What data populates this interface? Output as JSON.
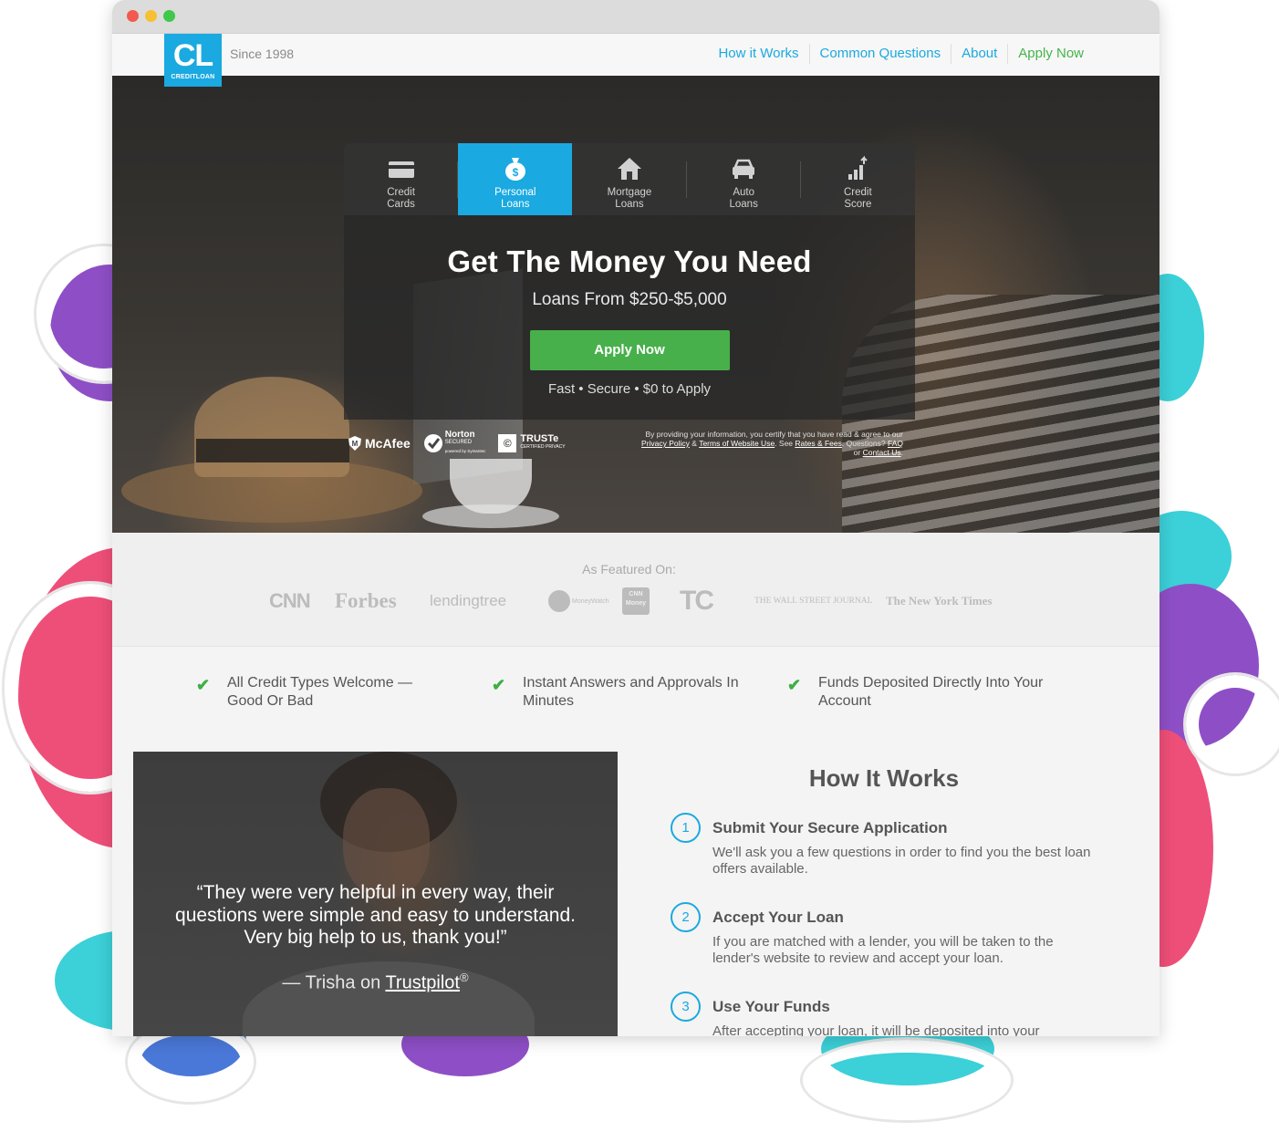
{
  "browser": {
    "controls": [
      "close",
      "minimize",
      "maximize"
    ]
  },
  "header": {
    "logo": {
      "mark": "CL",
      "name": "CREDITLOAN"
    },
    "since": "Since 1998",
    "nav": [
      {
        "label": "How it Works"
      },
      {
        "label": "Common Questions"
      },
      {
        "label": "About"
      },
      {
        "label": "Apply Now"
      }
    ]
  },
  "hero": {
    "tabs": [
      {
        "line1": "Credit",
        "line2": "Cards",
        "icon": "credit-card-icon"
      },
      {
        "line1": "Personal",
        "line2": "Loans",
        "icon": "money-bag-icon",
        "active": true
      },
      {
        "line1": "Mortgage",
        "line2": "Loans",
        "icon": "house-icon"
      },
      {
        "line1": "Auto",
        "line2": "Loans",
        "icon": "car-icon"
      },
      {
        "line1": "Credit",
        "line2": "Score",
        "icon": "bar-chart-icon"
      }
    ],
    "headline": "Get The Money You Need",
    "subline": "Loans From $250-$5,000",
    "cta": "Apply Now",
    "tagline": "Fast • Secure • $0 to Apply",
    "badges": {
      "mcafee": "McAfee",
      "norton": "Norton",
      "norton_sub": "SECURED",
      "norton_small": "powered by Symantec",
      "truste": "TRUSTe",
      "truste_sub": "CERTIFIED PRIVACY"
    },
    "disclaimer": {
      "text1": "By providing your information, you certify that you have read & agree to our ",
      "privacy": "Privacy Policy",
      "amp": " & ",
      "terms": "Terms of Website Use",
      "see": ". See ",
      "rates": "Rates & Fees",
      "questions": ". Questions? ",
      "faq": "FAQ",
      "or": " or ",
      "contact": "Contact Us",
      "end": "."
    }
  },
  "featured": {
    "label": "As Featured On:",
    "logos": [
      "CNN",
      "Forbes",
      "lendingtree",
      "MoneyWatch",
      "CNN Money",
      "TC",
      "THE WALL STREET JOURNAL",
      "The New York Times"
    ]
  },
  "features": [
    {
      "text": "All Credit Types Welcome — Good Or Bad"
    },
    {
      "text": "Instant Answers and Approvals In Minutes"
    },
    {
      "text": "Funds Deposited Directly Into Your Account"
    }
  ],
  "testimonial": {
    "quote": "“They were very helpful in every way, their questions were simple and easy to understand. Very big help to us, thank you!”",
    "author_prefix": "— Trisha on ",
    "author_link": "Trustpilot",
    "reg": "®"
  },
  "how_it_works": {
    "title": "How It Works",
    "steps": [
      {
        "num": "1",
        "title": "Submit Your Secure Application",
        "text": "We'll ask you a few questions in order to find you the best loan offers available."
      },
      {
        "num": "2",
        "title": "Accept Your Loan",
        "text": "If you are matched with a lender, you will be taken to the lender's website to review and accept your loan."
      },
      {
        "num": "3",
        "title": "Use Your Funds",
        "text": "After accepting your loan, it will be deposited into your"
      }
    ]
  },
  "colors": {
    "brand_blue": "#1aa9e0",
    "cta_green": "#47b04b",
    "splash_purple": "#8e4fc6",
    "splash_teal": "#3cd0d8",
    "splash_pink": "#ee4f78"
  }
}
